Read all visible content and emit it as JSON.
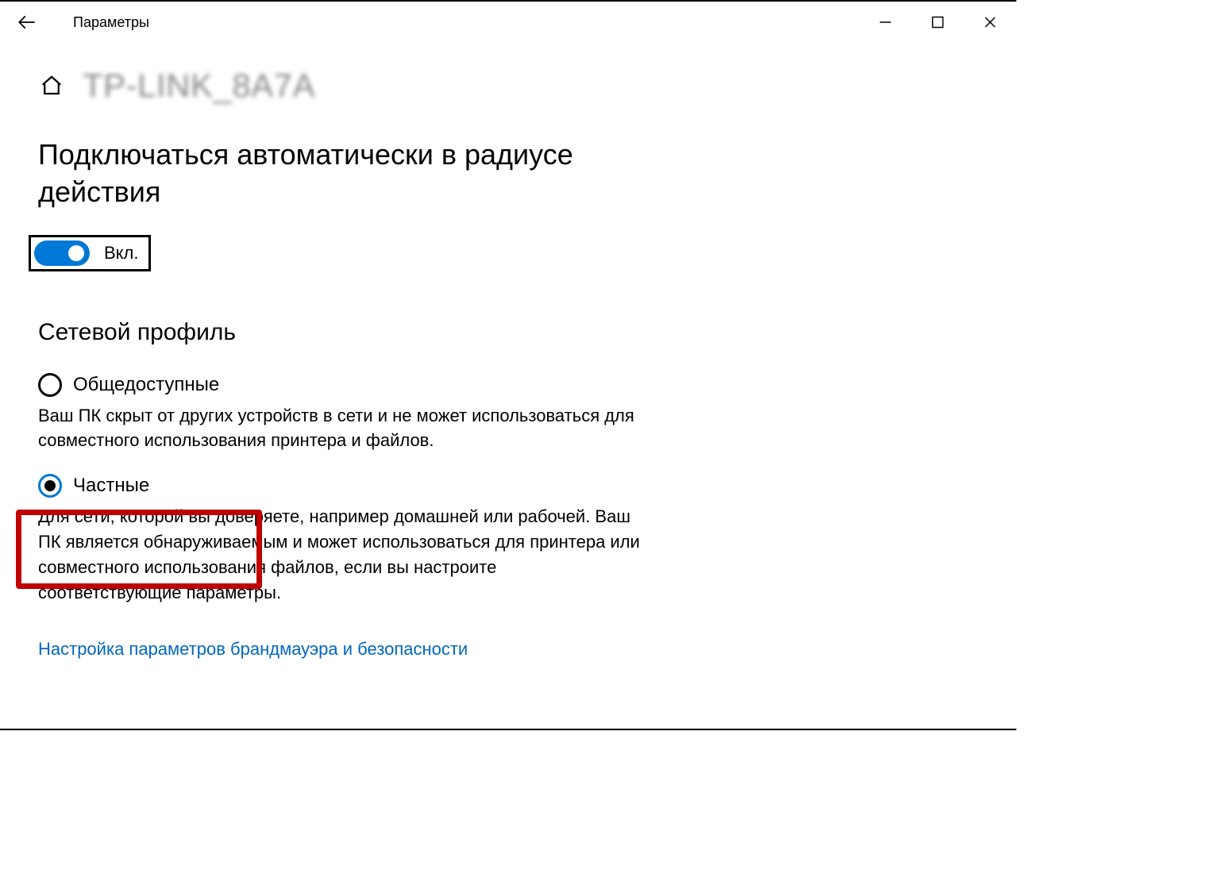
{
  "titlebar": {
    "title": "Параметры"
  },
  "header": {
    "network_name": "TP-LINK_8A7A"
  },
  "auto_connect": {
    "heading": "Подключаться автоматически в радиусе действия",
    "toggle_state_label": "Вкл."
  },
  "network_profile": {
    "heading": "Сетевой профиль",
    "options": [
      {
        "label": "Общедоступные",
        "description": "Ваш ПК скрыт от других устройств в сети и не может использоваться для совместного использования принтера и файлов.",
        "selected": false
      },
      {
        "label": "Частные",
        "description": "Для сети, которой вы доверяете, например домашней или рабочей. Ваш ПК является обнаруживаемым и может использоваться для принтера или совместного использования файлов, если вы настроите соответствующие параметры.",
        "selected": true
      }
    ],
    "firewall_link": "Настройка параметров брандмауэра и безопасности"
  }
}
